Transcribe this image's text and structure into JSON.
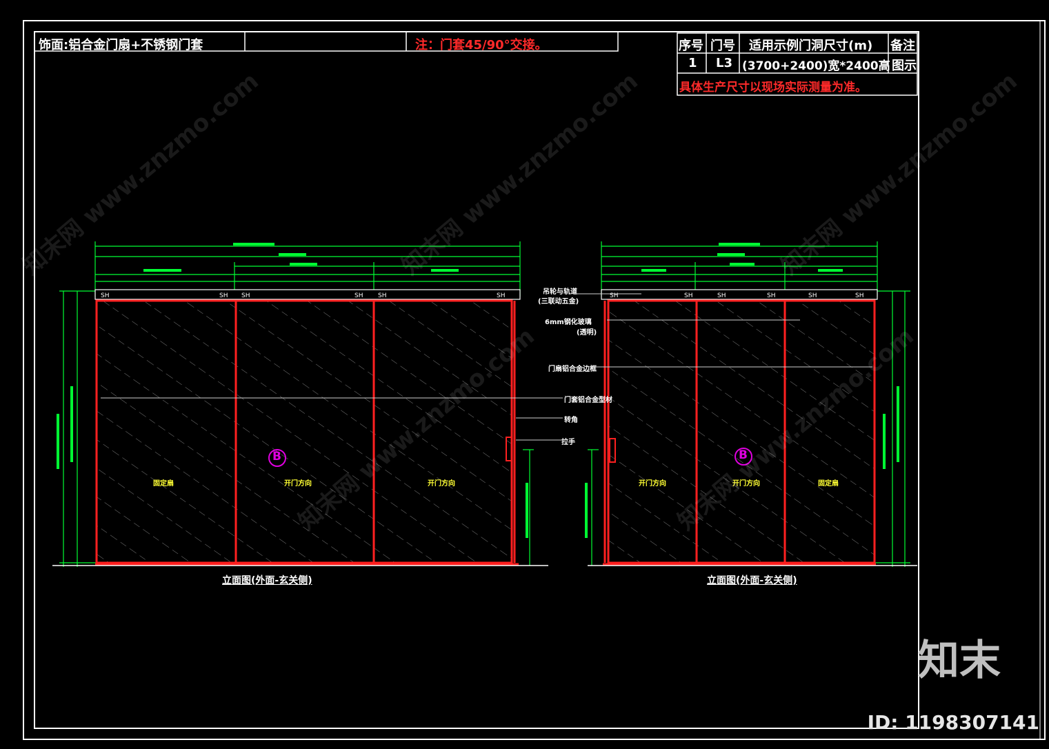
{
  "title_block": {
    "material": "饰面:铝合金门扇+不锈钢门套",
    "note": "注：门套45/90°交接。"
  },
  "spec_table": {
    "headers": [
      "序号",
      "门号",
      "适用示例门洞尺寸(m)",
      "备注"
    ],
    "row": [
      "1",
      "L3",
      "(3700+2400)宽*2400高",
      "图示"
    ],
    "footer_note": "具体生产尺寸以现场实际测量为准。"
  },
  "callouts": {
    "c1a": "吊轮与轨道",
    "c1b": "(三联动五金)",
    "c2a": "6mm钢化玻璃",
    "c2b": "(透明)",
    "c3": "门扇铝合金边框",
    "c4": "门套铝合金型材",
    "c5": "转角",
    "c6": "拉手"
  },
  "left_view": {
    "label": "立面图(外面-玄关侧)",
    "panel_labels": [
      "固定扇",
      "开门方向",
      "开门方向"
    ],
    "marker": "B"
  },
  "right_view": {
    "label": "立面图(外面-玄关侧)",
    "panel_labels": [
      "开门方向",
      "开门方向",
      "固定扇"
    ],
    "marker": "B"
  },
  "watermark": "知末网 www.znzmo.com",
  "brand": {
    "logo_text": "知末",
    "id_text": "ID: 1198307141"
  },
  "colors": {
    "background": "#000000",
    "frame": "#ffffff",
    "dimension": "#00ff33",
    "door_frame": "#ff2020",
    "hatch": "#8a8a8a",
    "label_yellow": "#ffff33",
    "marker_magenta": "#e000e0",
    "note_red": "#ff2a2a"
  }
}
